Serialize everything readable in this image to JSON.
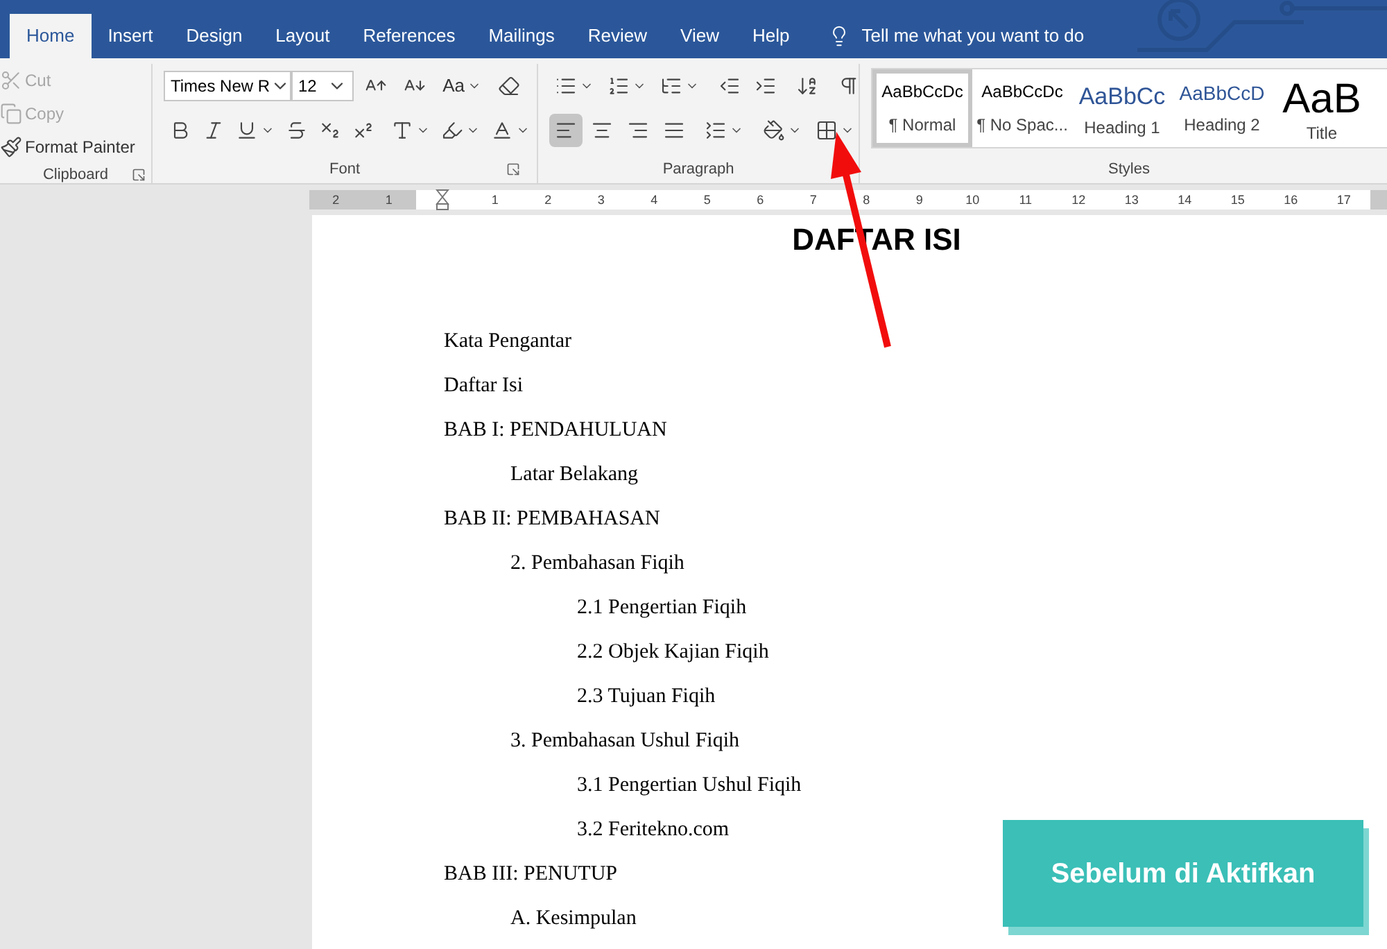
{
  "tabs": [
    {
      "label": "Home",
      "selected": true
    },
    {
      "label": "Insert",
      "selected": false
    },
    {
      "label": "Design",
      "selected": false
    },
    {
      "label": "Layout",
      "selected": false
    },
    {
      "label": "References",
      "selected": false
    },
    {
      "label": "Mailings",
      "selected": false
    },
    {
      "label": "Review",
      "selected": false
    },
    {
      "label": "View",
      "selected": false
    },
    {
      "label": "Help",
      "selected": false
    }
  ],
  "tell_me": "Tell me what you want to do",
  "clipboard": {
    "label": "Clipboard",
    "cut": {
      "label": "Cut",
      "disabled": true
    },
    "copy": {
      "label": "Copy",
      "disabled": true
    },
    "format_painter": {
      "label": "Format Painter",
      "disabled": false
    }
  },
  "font": {
    "label": "Font",
    "name": "Times New R",
    "size": "12",
    "change_case": "Aa"
  },
  "paragraph": {
    "label": "Paragraph",
    "alignments": [
      {
        "kind": "left",
        "selected": true
      },
      {
        "kind": "center",
        "selected": false
      },
      {
        "kind": "right",
        "selected": false
      },
      {
        "kind": "justify",
        "selected": false
      }
    ],
    "show_marks": {
      "on": false
    }
  },
  "styles": {
    "label": "Styles",
    "items": [
      {
        "kind": "normal",
        "preview": "AaBbCcDc",
        "name": "¶ Normal",
        "selected": true
      },
      {
        "kind": "normal",
        "preview": "AaBbCcDc",
        "name": "¶ No Spac...",
        "selected": false
      },
      {
        "kind": "heading1",
        "preview": "AaBbCc",
        "name": "Heading 1",
        "selected": false
      },
      {
        "kind": "heading2",
        "preview": "AaBbCcD",
        "name": "Heading 2",
        "selected": false
      },
      {
        "kind": "title",
        "preview": "AaB",
        "name": "Title",
        "selected": false
      }
    ]
  },
  "ruler": {
    "labels": [
      "2",
      "1",
      "1",
      "2",
      "3",
      "4",
      "5",
      "6",
      "7",
      "8",
      "9",
      "10",
      "11",
      "12",
      "13",
      "14",
      "15",
      "16",
      "17"
    ]
  },
  "document": {
    "title": "DAFTAR ISI",
    "entries": [
      {
        "text": "Kata Pengantar"
      },
      {
        "text": "Daftar Isi"
      },
      {
        "text": "BAB I: PENDAHULUAN",
        "children": [
          {
            "text": "Latar Belakang"
          }
        ]
      },
      {
        "text": "BAB II: PEMBAHASAN",
        "children": [
          {
            "text": "2. Pembahasan Fiqih",
            "children": [
              {
                "text": "2.1 Pengertian Fiqih"
              },
              {
                "text": "2.2 Objek Kajian Fiqih"
              },
              {
                "text": "2.3 Tujuan Fiqih"
              }
            ]
          },
          {
            "text": "3. Pembahasan Ushul Fiqih",
            "children": [
              {
                "text": "3.1 Pengertian Ushul Fiqih"
              },
              {
                "text": "3.2 Feritekno.com"
              }
            ]
          }
        ]
      },
      {
        "text": "BAB III: PENUTUP",
        "children": [
          {
            "text": "A. Kesimpulan"
          }
        ]
      }
    ]
  },
  "banner": "Sebelum di Aktifkan"
}
